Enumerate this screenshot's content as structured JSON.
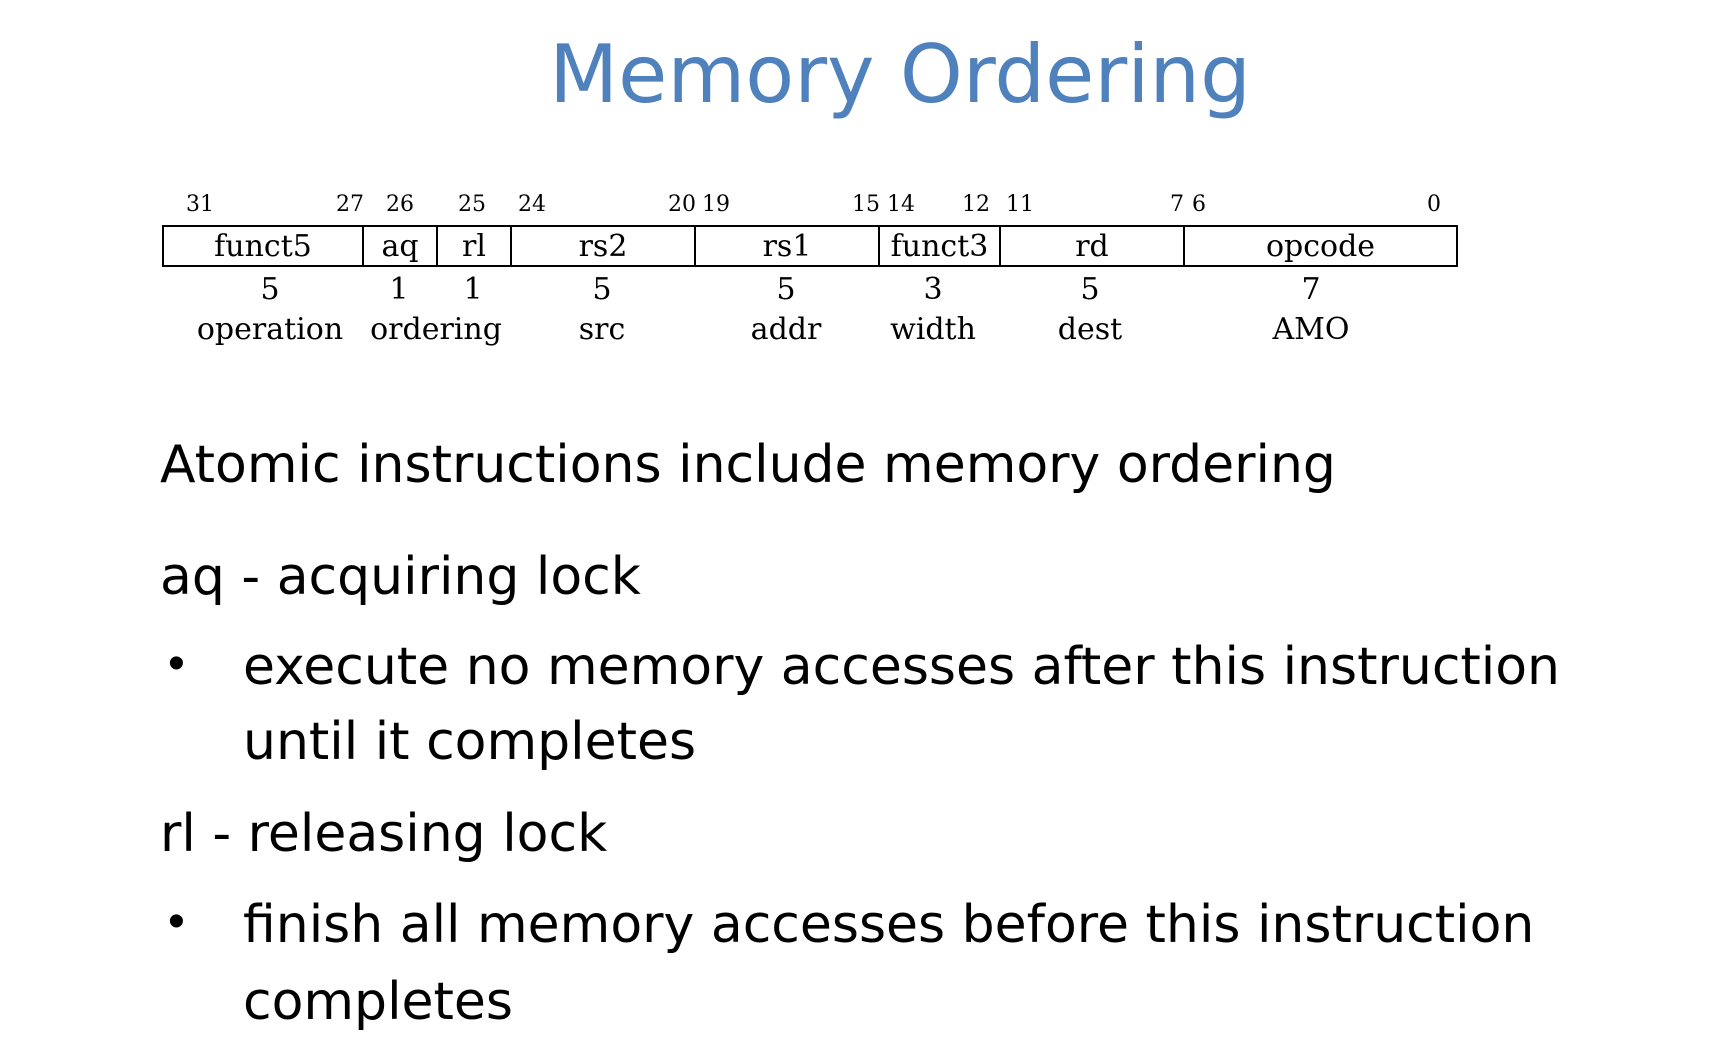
{
  "slide": {
    "title": "Memory Ordering"
  },
  "encoding": {
    "bit_labels": [
      "31",
      "27",
      "26",
      "25",
      "24",
      "20",
      "19",
      "15",
      "14",
      "12",
      "11",
      "7",
      "6",
      "0"
    ],
    "fields": [
      {
        "name": "funct5",
        "width": "5",
        "role": "operation"
      },
      {
        "name": "aq",
        "width": "1",
        "role": ""
      },
      {
        "name": "rl",
        "width": "1",
        "role": ""
      },
      {
        "name": "rs2",
        "width": "5",
        "role": "src"
      },
      {
        "name": "rs1",
        "width": "5",
        "role": "addr"
      },
      {
        "name": "funct3",
        "width": "3",
        "role": "width"
      },
      {
        "name": "rd",
        "width": "5",
        "role": "dest"
      },
      {
        "name": "opcode",
        "width": "7",
        "role": "AMO"
      }
    ],
    "aq_rl_role": "ordering"
  },
  "content": {
    "intro": "Atomic instructions include memory ordering",
    "aq_heading": "aq - acquiring lock",
    "aq_bullet_line1": "execute no memory accesses after this instruction",
    "aq_bullet_line2": "until it completes",
    "rl_heading": "rl - releasing lock",
    "rl_bullet_line1": "finish all memory accesses before this instruction",
    "rl_bullet_line2": "completes",
    "bullet_glyph": "•"
  }
}
